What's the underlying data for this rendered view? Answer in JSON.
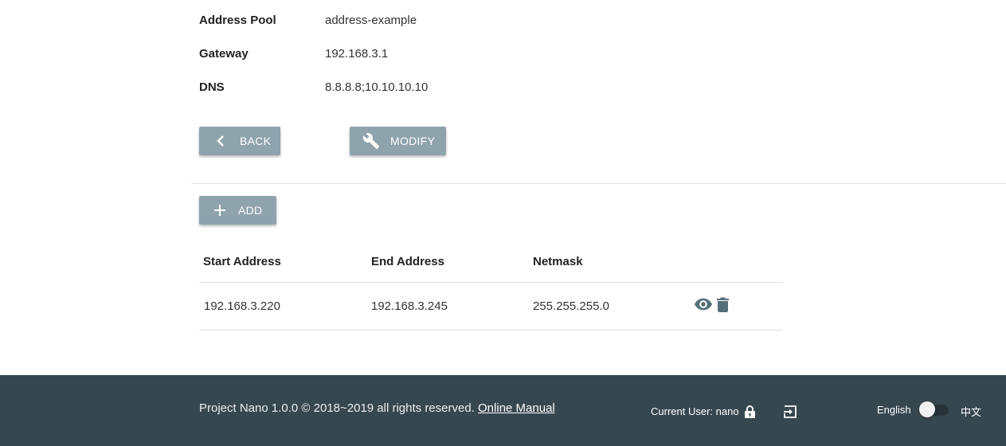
{
  "details": {
    "address_pool_label": "Address Pool",
    "address_pool_value": "address-example",
    "gateway_label": "Gateway",
    "gateway_value": "192.168.3.1",
    "dns_label": "DNS",
    "dns_value": "8.8.8.8;10.10.10.10"
  },
  "actions": {
    "back_label": "BACK",
    "modify_label": "MODIFY",
    "add_label": "ADD"
  },
  "table": {
    "headers": [
      "Start Address",
      "End Address",
      "Netmask"
    ],
    "rows": [
      {
        "start": "192.168.3.220",
        "end": "192.168.3.245",
        "netmask": "255.255.255.0"
      }
    ]
  },
  "footer": {
    "copyright": "Project Nano 1.0.0 © 2018~2019 all rights reserved.",
    "manual_link": "Online Manual",
    "current_user": "Current User: nano",
    "lang_english": "English",
    "lang_chinese": "中文"
  },
  "icons": {
    "back": "chevron-left-icon",
    "modify": "wrench-icon",
    "add": "plus-icon",
    "view": "eye-icon",
    "delete": "trash-icon",
    "lock": "lock-icon",
    "logout": "logout-icon"
  },
  "colors": {
    "button_bg": "#8fa3ad",
    "footer_bg": "#37474f",
    "action_icon": "#546e7a"
  }
}
